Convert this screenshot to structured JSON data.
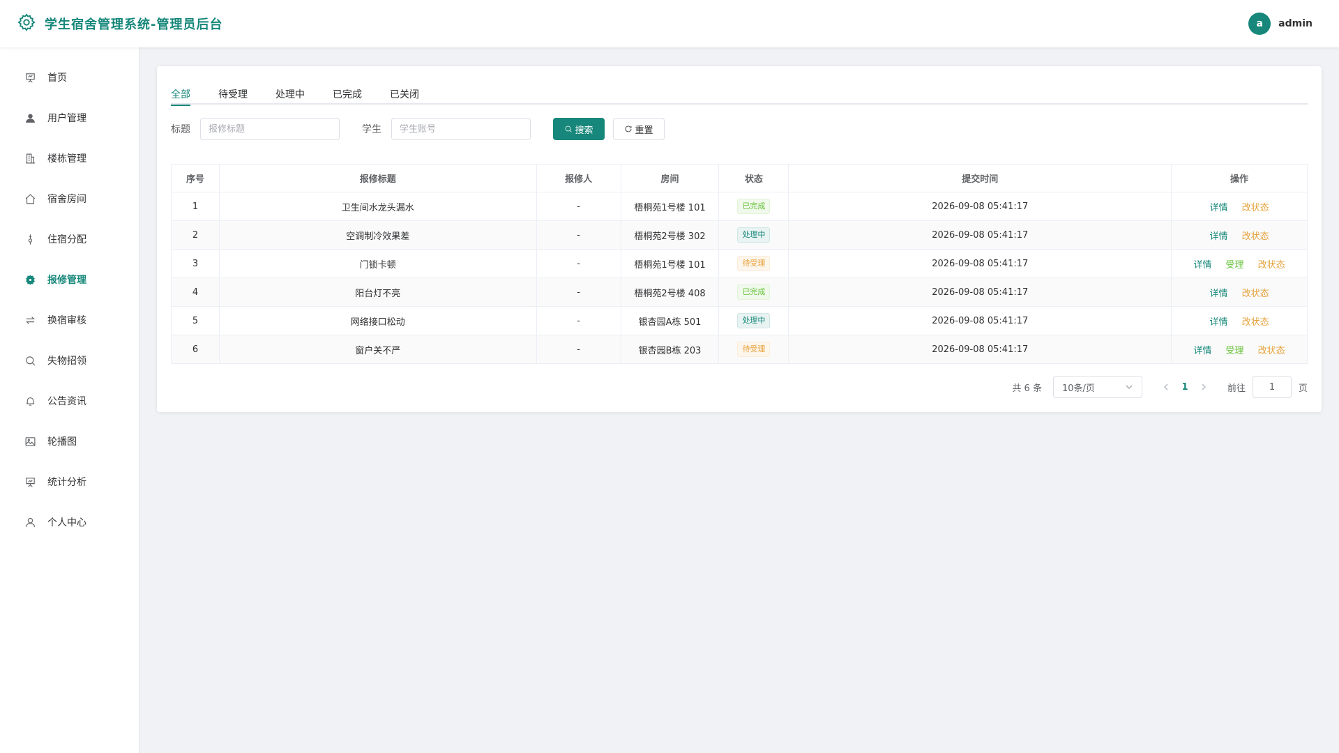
{
  "brand": {
    "title": "学生宿舍管理系统-管理员后台",
    "icon": "gear-icon",
    "accent": "#16877a"
  },
  "user": {
    "avatar_letter": "a",
    "name": "admin"
  },
  "sidebar": {
    "items": [
      {
        "label": "首页",
        "icon": "presentation-icon"
      },
      {
        "label": "用户管理",
        "icon": "user-icon"
      },
      {
        "label": "楼栋管理",
        "icon": "building-icon"
      },
      {
        "label": "宿舍房间",
        "icon": "house-icon"
      },
      {
        "label": "住宿分配",
        "icon": "bed-icon"
      },
      {
        "label": "报修管理",
        "icon": "gear-icon",
        "active": true
      },
      {
        "label": "换宿审核",
        "icon": "swap-icon"
      },
      {
        "label": "失物招领",
        "icon": "search-icon"
      },
      {
        "label": "公告资讯",
        "icon": "bell-icon"
      },
      {
        "label": "轮播图",
        "icon": "image-icon"
      },
      {
        "label": "统计分析",
        "icon": "chart-board-icon"
      },
      {
        "label": "个人中心",
        "icon": "person-icon"
      }
    ]
  },
  "tabs": [
    "全部",
    "待受理",
    "处理中",
    "已完成",
    "已关闭"
  ],
  "filter": {
    "title_label": "标题",
    "title_placeholder": "报修标题",
    "student_label": "学生",
    "student_placeholder": "学生账号",
    "search_label": "搜索",
    "reset_label": "重置"
  },
  "table": {
    "headers": [
      "序号",
      "报修标题",
      "报修人",
      "房间",
      "状态",
      "提交时间",
      "操作"
    ],
    "rows": [
      {
        "no": "1",
        "title": "卫生间水龙头漏水",
        "reporter": "-",
        "room": "梧桐苑1号楼 101",
        "status": "已完成",
        "status_type": "done",
        "time": "2026-09-08 05:41:17",
        "actions": [
          "详情",
          "改状态"
        ]
      },
      {
        "no": "2",
        "title": "空调制冷效果差",
        "reporter": "-",
        "room": "梧桐苑2号楼 302",
        "status": "处理中",
        "status_type": "proc",
        "time": "2026-09-08 05:41:17",
        "actions": [
          "详情",
          "改状态"
        ]
      },
      {
        "no": "3",
        "title": "门锁卡顿",
        "reporter": "-",
        "room": "梧桐苑1号楼 101",
        "status": "待受理",
        "status_type": "wait",
        "time": "2026-09-08 05:41:17",
        "actions": [
          "详情",
          "受理",
          "改状态"
        ]
      },
      {
        "no": "4",
        "title": "阳台灯不亮",
        "reporter": "-",
        "room": "梧桐苑2号楼 408",
        "status": "已完成",
        "status_type": "done",
        "time": "2026-09-08 05:41:17",
        "actions": [
          "详情",
          "改状态"
        ]
      },
      {
        "no": "5",
        "title": "网络接口松动",
        "reporter": "-",
        "room": "银杏园A栋 501",
        "status": "处理中",
        "status_type": "proc",
        "time": "2026-09-08 05:41:17",
        "actions": [
          "详情",
          "改状态"
        ]
      },
      {
        "no": "6",
        "title": "窗户关不严",
        "reporter": "-",
        "room": "银杏园B栋 203",
        "status": "待受理",
        "status_type": "wait",
        "time": "2026-09-08 05:41:17",
        "actions": [
          "详情",
          "受理",
          "改状态"
        ]
      }
    ]
  },
  "pagination": {
    "total_text": "共 6 条",
    "page_size": "10条/页",
    "current_page": "1",
    "goto_label": "前往",
    "goto_value": "1",
    "page_suffix": "页"
  }
}
